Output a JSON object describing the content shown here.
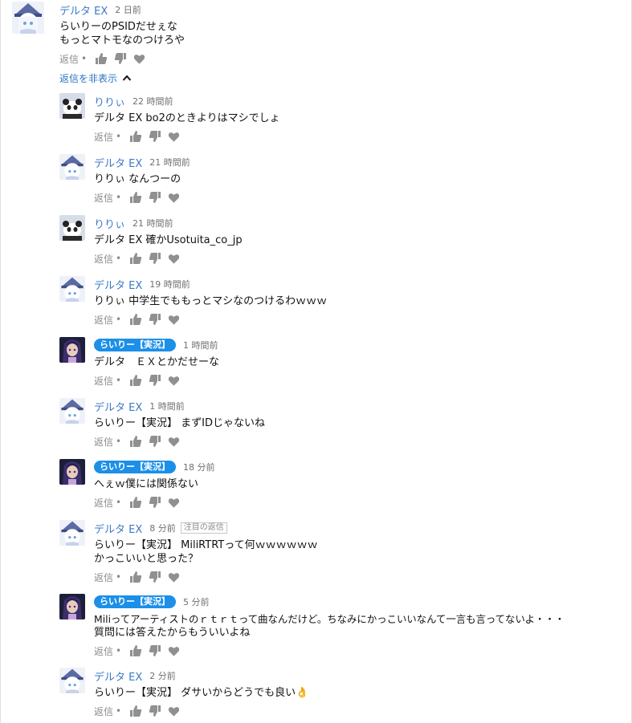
{
  "hide_replies": {
    "label": "返信を非表示"
  },
  "reply_label": "返信",
  "comments": [
    {
      "author": "デルタ EX",
      "time": "2 日前",
      "lines": [
        "らいりーのPSIDだせぇな",
        "もっとマトモなのつけろや"
      ],
      "avatar": "white-hair-girl"
    },
    {
      "author": "りりぃ",
      "time": "22 時間前",
      "lines": [
        "デルタ EX bo2のときよりはマシでしょ"
      ],
      "avatar": "panda"
    },
    {
      "author": "デルタ EX",
      "time": "21 時間前",
      "lines": [
        "りりぃ なんつーの"
      ],
      "avatar": "white-hair-girl"
    },
    {
      "author": "りりぃ",
      "time": "21 時間前",
      "lines": [
        "デルタ EX 確かUsotuita_co_jp"
      ],
      "avatar": "panda"
    },
    {
      "author": "デルタ EX",
      "time": "19 時間前",
      "lines": [
        "りりぃ 中学生でももっとマシなのつけるわｗｗｗ"
      ],
      "avatar": "white-hair-girl"
    },
    {
      "author": "らいりー【実況】",
      "time": "1 時間前",
      "lines": [
        "デルタ　ＥＸとかだせーな"
      ],
      "avatar": "dark-hair-character",
      "owner": true
    },
    {
      "author": "デルタ EX",
      "time": "1 時間前",
      "lines": [
        "らいりー【実況】 まずIDじゃないね"
      ],
      "avatar": "white-hair-girl"
    },
    {
      "author": "らいりー【実況】",
      "time": "18 分前",
      "lines": [
        "へぇｗ僕には関係ない"
      ],
      "avatar": "dark-hair-character",
      "owner": true
    },
    {
      "author": "デルタ EX",
      "time": "8 分前",
      "badge": "注目の返信",
      "lines": [
        "らいりー【実況】 MiliRTRTって何ｗｗｗｗｗｗ",
        "かっこいいと思った？"
      ],
      "avatar": "white-hair-girl"
    },
    {
      "author": "らいりー【実況】",
      "time": "5 分前",
      "lines": [
        "Miliってアーティストのｒｔｒｔって曲なんだけど。ちなみにかっこいいなんて一言も言ってないよ・・・",
        "質問には答えたからもういいよね"
      ],
      "avatar": "dark-hair-character",
      "owner": true
    },
    {
      "author": "デルタ EX",
      "time": "2 分前",
      "lines": [
        "らいりー【実況】 ダサいからどうでも良い👌"
      ],
      "avatar": "white-hair-girl"
    }
  ],
  "icons": {
    "like": "thumbs-up-icon",
    "dislike": "thumbs-down-icon",
    "heart": "heart-icon",
    "chevron": "chevron-up-icon"
  },
  "colors": {
    "author_link": "#3a79c6",
    "owner_chip": "#1c8fe8",
    "secondary_text": "#8a8a8a"
  }
}
